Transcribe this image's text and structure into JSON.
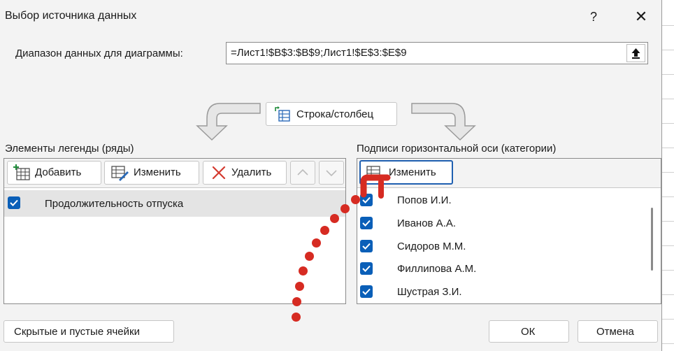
{
  "dialog": {
    "title": "Выбор источника данных",
    "help_label": "?",
    "close_label": "✕"
  },
  "range": {
    "label": "Диапазон данных для диаграммы:",
    "value": "=Лист1!$B$3:$B$9;Лист1!$E$3:$E$9"
  },
  "switch_button": {
    "label": "Строка/столбец"
  },
  "legend": {
    "title": "Элементы легенды (ряды)",
    "buttons": {
      "add": "Добавить",
      "edit": "Изменить",
      "delete": "Удалить"
    },
    "series": [
      {
        "label": "Продолжительность отпуска",
        "checked": true
      }
    ]
  },
  "axis": {
    "title": "Подписи горизонтальной оси (категории)",
    "edit_button": "Изменить",
    "items": [
      {
        "label": "Попов И.И.",
        "checked": true
      },
      {
        "label": "Иванов А.А.",
        "checked": true
      },
      {
        "label": "Сидоров М.М.",
        "checked": true
      },
      {
        "label": "Филлипова А.М.",
        "checked": true
      },
      {
        "label": "Шустрая З.И.",
        "checked": true
      }
    ]
  },
  "footer": {
    "hidden_cells_button": "Скрытые и пустые ячейки",
    "ok_button": "ОК",
    "cancel_button": "Отмена"
  },
  "colors": {
    "accent": "#0a5fb8",
    "annotation": "#d62b22"
  }
}
